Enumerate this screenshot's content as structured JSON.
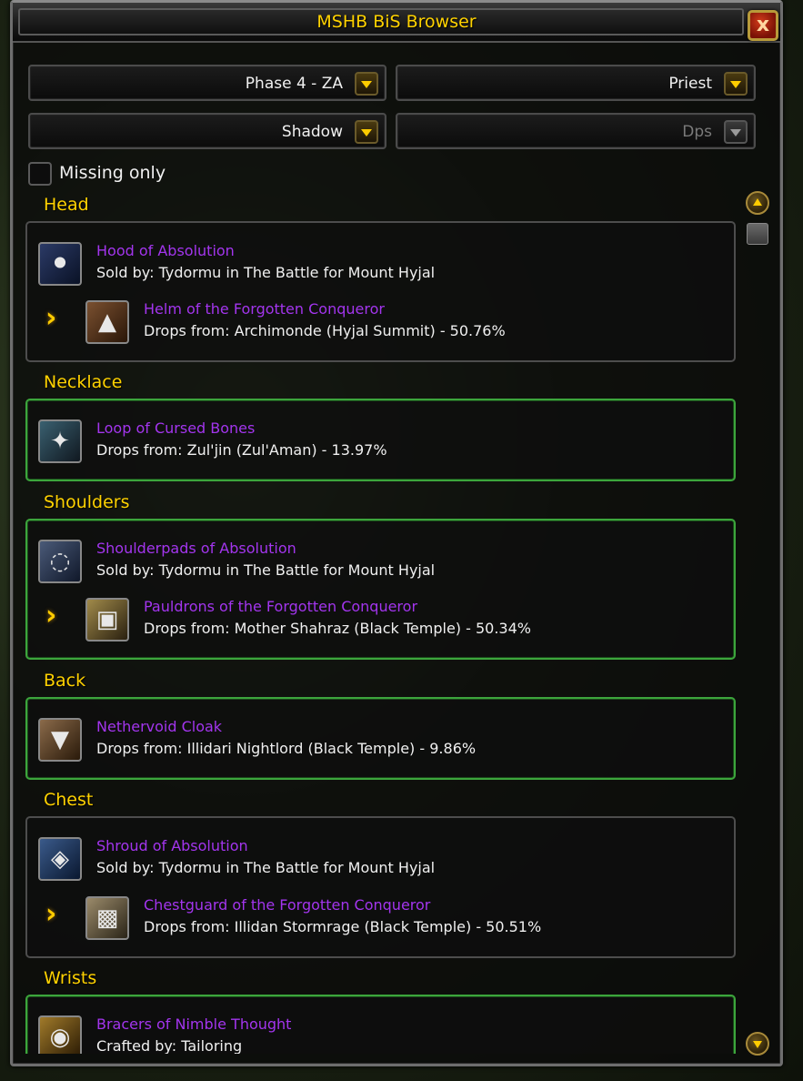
{
  "window": {
    "title": "MSHB BiS Browser",
    "close_label": "x"
  },
  "filters": {
    "phase": "Phase 4 - ZA",
    "class": "Priest",
    "spec": "Shadow",
    "role": "Dps"
  },
  "missing_only": {
    "label": "Missing only",
    "checked": false
  },
  "slots": [
    {
      "title": "Head",
      "items": [
        {
          "name": "Hood of Absolution",
          "source": "Sold by: Tydormu in The Battle for Mount Hyjal",
          "icon": "hood-icon"
        },
        {
          "name": "Helm of the Forgotten Conqueror",
          "source": "Drops from: Archimonde (Hyjal Summit)  - 50.76%",
          "icon": "helm-icon"
        }
      ]
    },
    {
      "title": "Necklace",
      "items": [
        {
          "name": "Loop of Cursed Bones",
          "source": "Drops from: Zul'jin (Zul'Aman)  - 13.97%",
          "icon": "necklace-icon"
        }
      ]
    },
    {
      "title": "Shoulders",
      "items": [
        {
          "name": "Shoulderpads of Absolution",
          "source": "Sold by: Tydormu in The Battle for Mount Hyjal",
          "icon": "shoulderpads-icon"
        },
        {
          "name": "Pauldrons of the Forgotten Conqueror",
          "source": "Drops from: Mother Shahraz (Black Temple)  - 50.34%",
          "icon": "pauldrons-icon"
        }
      ]
    },
    {
      "title": "Back",
      "items": [
        {
          "name": "Nethervoid Cloak",
          "source": "Drops from: Illidari Nightlord (Black Temple)  - 9.86%",
          "icon": "cloak-icon"
        }
      ]
    },
    {
      "title": "Chest",
      "items": [
        {
          "name": "Shroud of Absolution",
          "source": "Sold by: Tydormu in The Battle for Mount Hyjal",
          "icon": "shroud-icon"
        },
        {
          "name": "Chestguard of the Forgotten Conqueror",
          "source": "Drops from: Illidan Stormrage (Black Temple)  - 50.51%",
          "icon": "chestguard-icon"
        }
      ]
    },
    {
      "title": "Wrists",
      "items": [
        {
          "name": "Bracers of Nimble Thought",
          "source": "Crafted by: Tailoring",
          "icon": "bracers-icon"
        }
      ]
    }
  ],
  "colors": {
    "epic": "#a335ee",
    "header": "#ffd200",
    "owned_border": "#3ca53c"
  }
}
